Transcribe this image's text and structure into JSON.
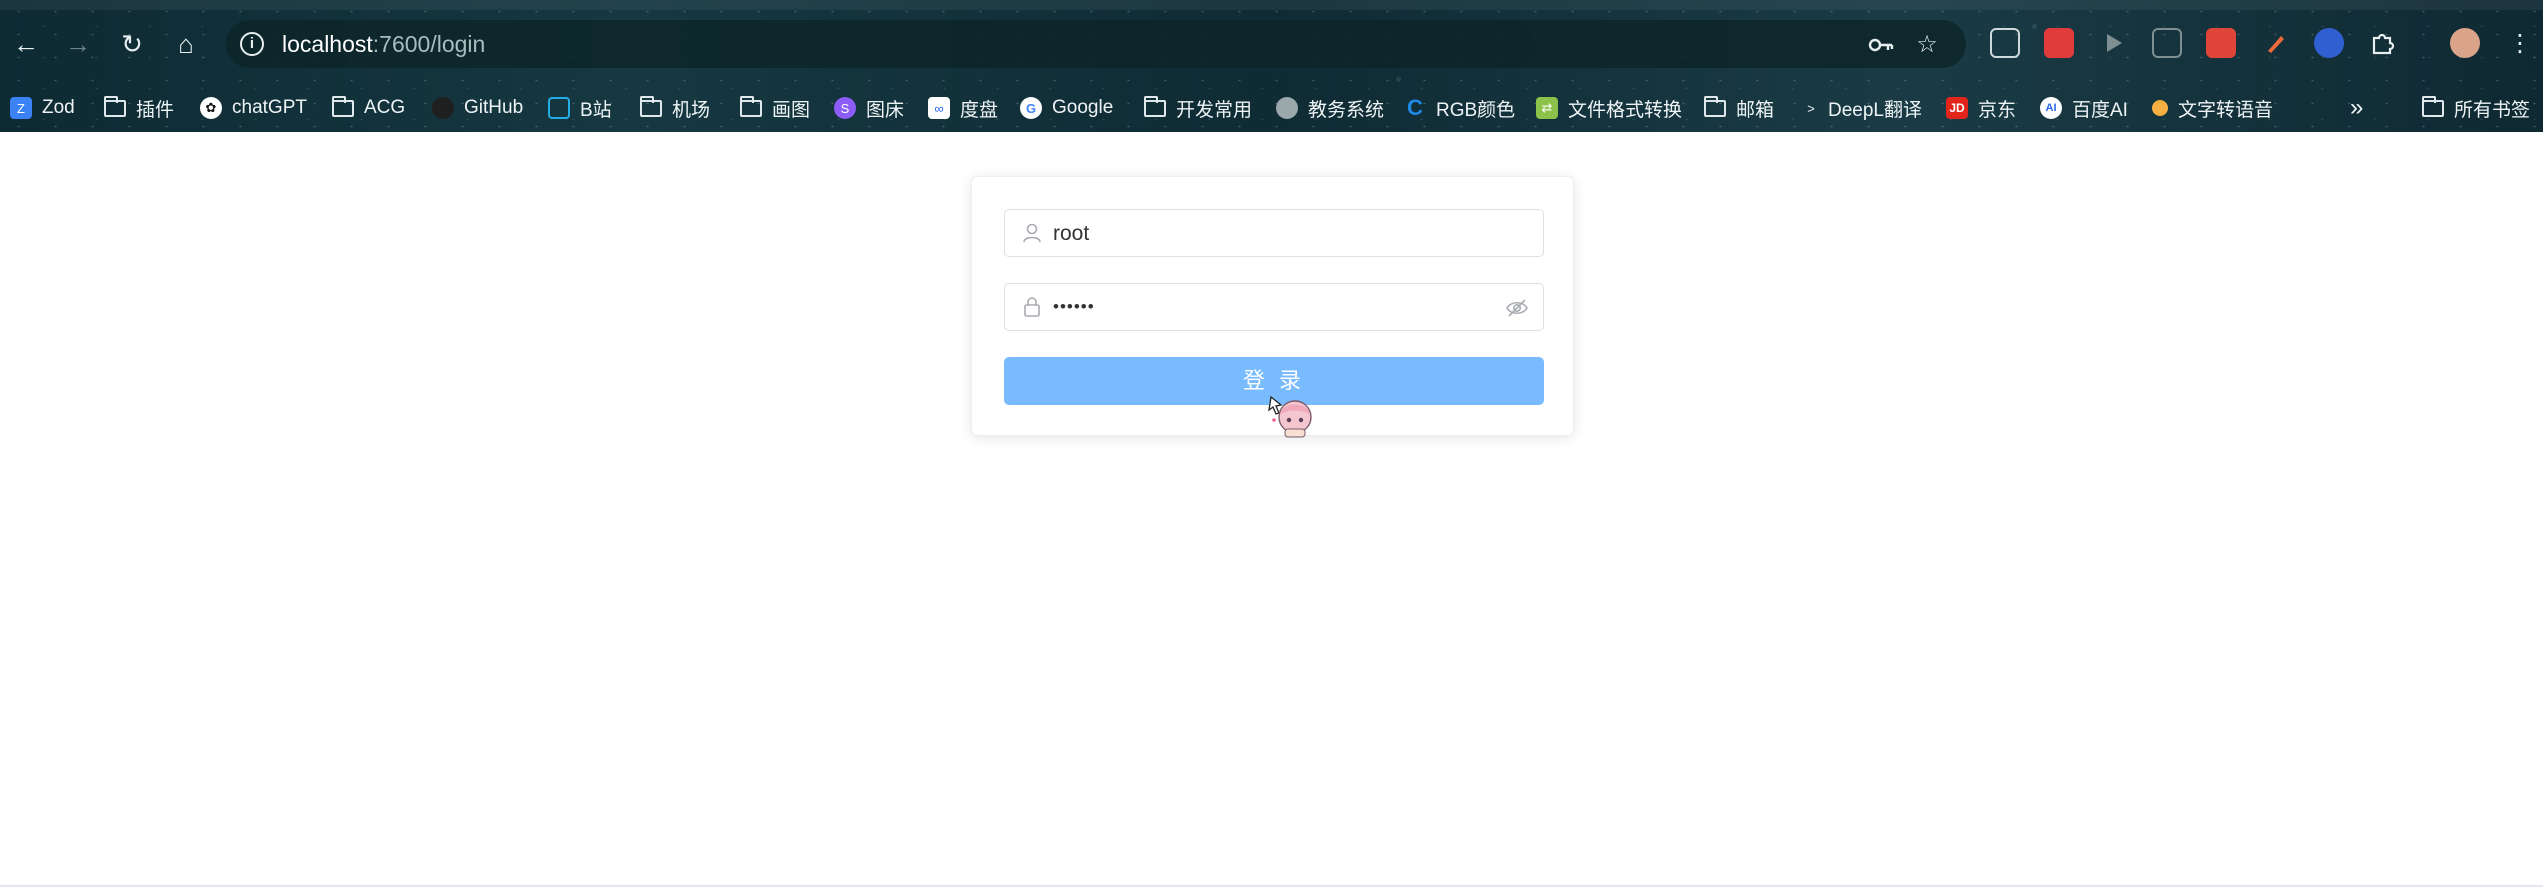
{
  "browser": {
    "url_host": "localhost",
    "url_rest": ":7600/login",
    "bookmarks": [
      {
        "label": "Zod",
        "icon": "zod-icon",
        "color": "#3b82f6"
      },
      {
        "label": "插件",
        "icon": "folder-icon"
      },
      {
        "label": "chatGPT",
        "icon": "chatgpt-icon",
        "color": "#ffffff"
      },
      {
        "label": "ACG",
        "icon": "folder-icon"
      },
      {
        "label": "GitHub",
        "icon": "github-icon",
        "color": "#222222"
      },
      {
        "label": "B站",
        "icon": "bilibili-icon",
        "color": "#23ade5"
      },
      {
        "label": "机场",
        "icon": "folder-icon"
      },
      {
        "label": "画图",
        "icon": "folder-icon"
      },
      {
        "label": "图床",
        "icon": "image-host-icon",
        "color": "#8b5cf6"
      },
      {
        "label": "度盘",
        "icon": "baidu-pan-icon",
        "color": "#ffffff"
      },
      {
        "label": "Google",
        "icon": "google-icon",
        "color": "#ffffff"
      },
      {
        "label": "开发常用",
        "icon": "folder-icon"
      },
      {
        "label": "教务系统",
        "icon": "globe-icon",
        "color": "#9aa8ab"
      },
      {
        "label": "RGB颜色",
        "icon": "rgb-color-icon",
        "color": "#1e88e5"
      },
      {
        "label": "文件格式转换",
        "icon": "file-convert-icon",
        "color": "#8bc34a"
      },
      {
        "label": "邮箱",
        "icon": "folder-icon"
      },
      {
        "label": "DeepL翻译",
        "icon": "deepl-icon",
        "color": "#0f2b46"
      },
      {
        "label": "京东",
        "icon": "jd-icon",
        "color": "#e1251b"
      },
      {
        "label": "百度AI",
        "icon": "baidu-ai-icon",
        "color": "#ffffff"
      },
      {
        "label": "文字转语音",
        "icon": "tts-icon",
        "color": "#f5b041"
      }
    ],
    "other_bookmarks": "所有书签"
  },
  "login": {
    "username": "root",
    "password_mask": "••••••",
    "submit_label": "登 录"
  }
}
